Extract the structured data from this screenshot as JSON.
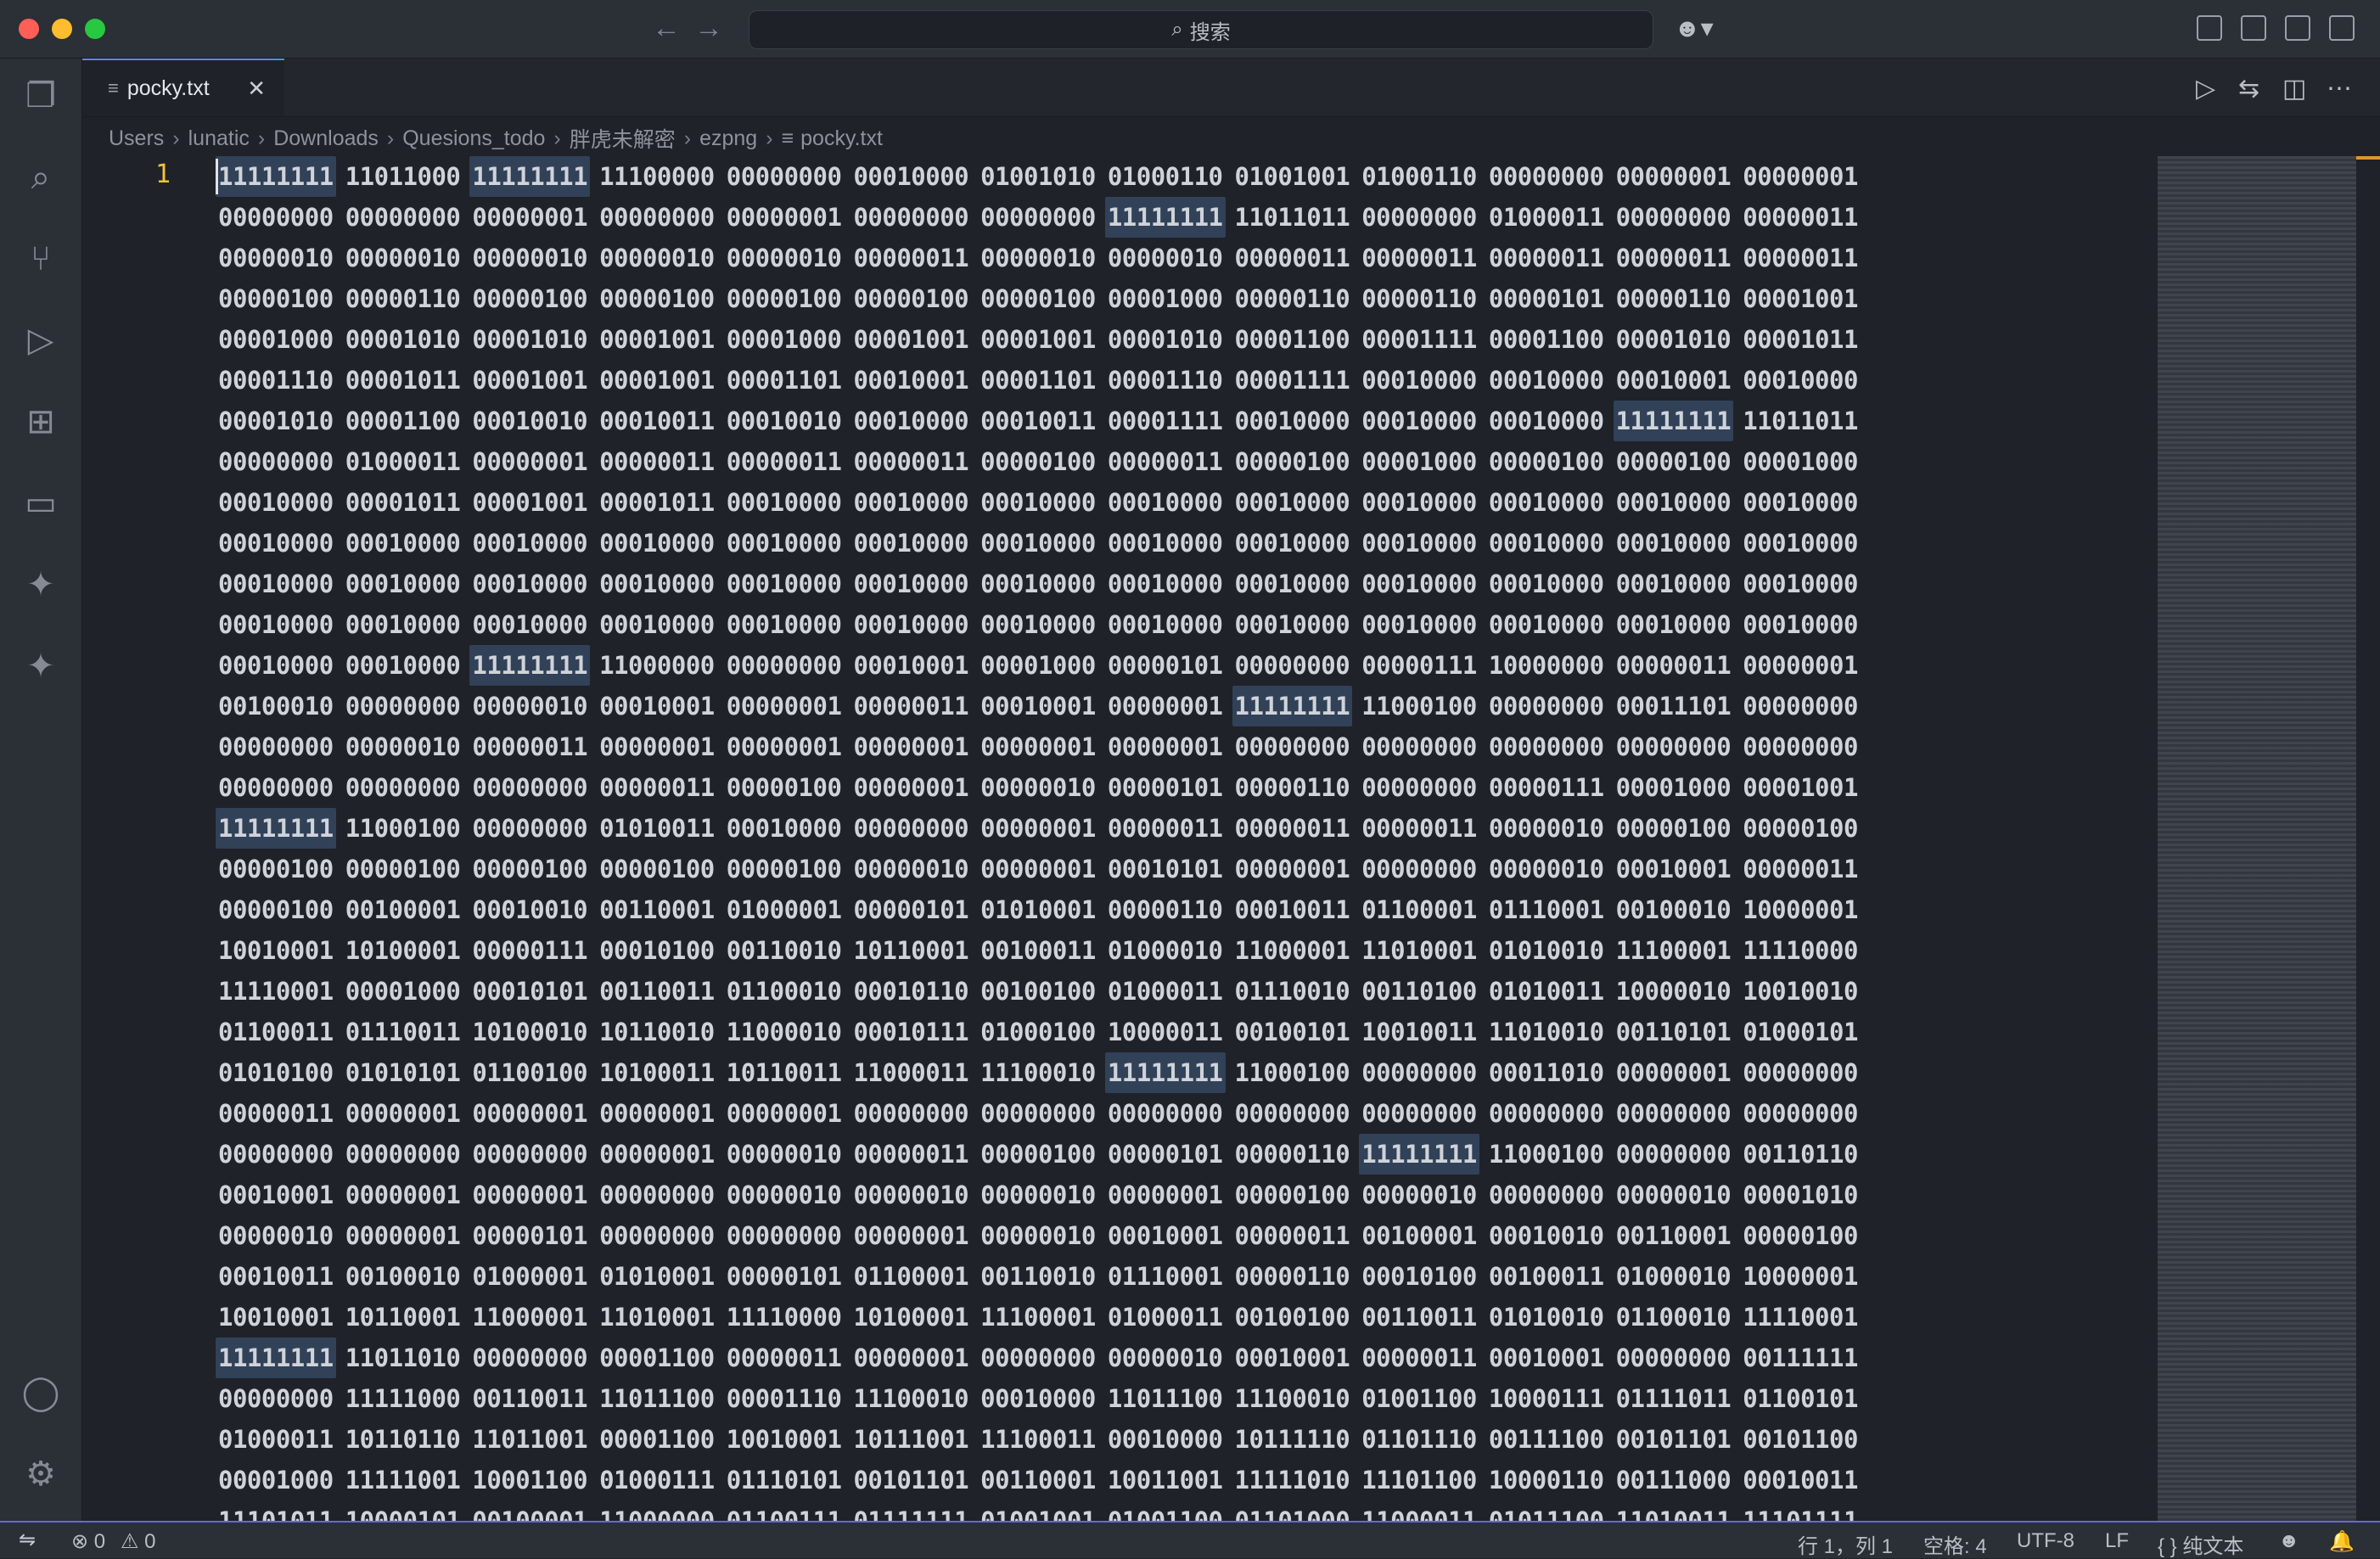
{
  "titlebar": {
    "search_placeholder": "搜索",
    "search_icon": "magnifier-icon",
    "copilot_icon": "copilot-icon"
  },
  "tab": {
    "file_icon": "text-file-icon",
    "name": "pocky.txt",
    "close": "✕"
  },
  "breadcrumb": {
    "parts": [
      "Users",
      "lunatic",
      "Downloads",
      "Quesions_todo",
      "胖虎未解密",
      "ezpng"
    ],
    "file": "pocky.txt"
  },
  "editor": {
    "line_number": "1",
    "lines": [
      [
        "11111111",
        "11011000",
        "11111111",
        "11100000",
        "00000000",
        "00010000",
        "01001010",
        "01000110",
        "01001001",
        "01000110",
        "00000000",
        "00000001",
        "00000001"
      ],
      [
        "00000000",
        "00000000",
        "00000001",
        "00000000",
        "00000001",
        "00000000",
        "00000000",
        "11111111",
        "11011011",
        "00000000",
        "01000011",
        "00000000",
        "00000011"
      ],
      [
        "00000010",
        "00000010",
        "00000010",
        "00000010",
        "00000010",
        "00000011",
        "00000010",
        "00000010",
        "00000011",
        "00000011",
        "00000011",
        "00000011",
        "00000011"
      ],
      [
        "00000100",
        "00000110",
        "00000100",
        "00000100",
        "00000100",
        "00000100",
        "00000100",
        "00001000",
        "00000110",
        "00000110",
        "00000101",
        "00000110",
        "00001001"
      ],
      [
        "00001000",
        "00001010",
        "00001010",
        "00001001",
        "00001000",
        "00001001",
        "00001001",
        "00001010",
        "00001100",
        "00001111",
        "00001100",
        "00001010",
        "00001011"
      ],
      [
        "00001110",
        "00001011",
        "00001001",
        "00001001",
        "00001101",
        "00010001",
        "00001101",
        "00001110",
        "00001111",
        "00010000",
        "00010000",
        "00010001",
        "00010000"
      ],
      [
        "00001010",
        "00001100",
        "00010010",
        "00010011",
        "00010010",
        "00010000",
        "00010011",
        "00001111",
        "00010000",
        "00010000",
        "00010000",
        "11111111",
        "11011011"
      ],
      [
        "00000000",
        "01000011",
        "00000001",
        "00000011",
        "00000011",
        "00000011",
        "00000100",
        "00000011",
        "00000100",
        "00001000",
        "00000100",
        "00000100",
        "00001000"
      ],
      [
        "00010000",
        "00001011",
        "00001001",
        "00001011",
        "00010000",
        "00010000",
        "00010000",
        "00010000",
        "00010000",
        "00010000",
        "00010000",
        "00010000",
        "00010000"
      ],
      [
        "00010000",
        "00010000",
        "00010000",
        "00010000",
        "00010000",
        "00010000",
        "00010000",
        "00010000",
        "00010000",
        "00010000",
        "00010000",
        "00010000",
        "00010000"
      ],
      [
        "00010000",
        "00010000",
        "00010000",
        "00010000",
        "00010000",
        "00010000",
        "00010000",
        "00010000",
        "00010000",
        "00010000",
        "00010000",
        "00010000",
        "00010000"
      ],
      [
        "00010000",
        "00010000",
        "00010000",
        "00010000",
        "00010000",
        "00010000",
        "00010000",
        "00010000",
        "00010000",
        "00010000",
        "00010000",
        "00010000",
        "00010000"
      ],
      [
        "00010000",
        "00010000",
        "11111111",
        "11000000",
        "00000000",
        "00010001",
        "00001000",
        "00000101",
        "00000000",
        "00000111",
        "10000000",
        "00000011",
        "00000001"
      ],
      [
        "00100010",
        "00000000",
        "00000010",
        "00010001",
        "00000001",
        "00000011",
        "00010001",
        "00000001",
        "11111111",
        "11000100",
        "00000000",
        "00011101",
        "00000000"
      ],
      [
        "00000000",
        "00000010",
        "00000011",
        "00000001",
        "00000001",
        "00000001",
        "00000001",
        "00000001",
        "00000000",
        "00000000",
        "00000000",
        "00000000",
        "00000000"
      ],
      [
        "00000000",
        "00000000",
        "00000000",
        "00000011",
        "00000100",
        "00000001",
        "00000010",
        "00000101",
        "00000110",
        "00000000",
        "00000111",
        "00001000",
        "00001001"
      ],
      [
        "11111111",
        "11000100",
        "00000000",
        "01010011",
        "00010000",
        "00000000",
        "00000001",
        "00000011",
        "00000011",
        "00000011",
        "00000010",
        "00000100",
        "00000100"
      ],
      [
        "00000100",
        "00000100",
        "00000100",
        "00000100",
        "00000100",
        "00000010",
        "00000001",
        "00010101",
        "00000001",
        "00000000",
        "00000010",
        "00010001",
        "00000011"
      ],
      [
        "00000100",
        "00100001",
        "00010010",
        "00110001",
        "01000001",
        "00000101",
        "01010001",
        "00000110",
        "00010011",
        "01100001",
        "01110001",
        "00100010",
        "10000001"
      ],
      [
        "10010001",
        "10100001",
        "00000111",
        "00010100",
        "00110010",
        "10110001",
        "00100011",
        "01000010",
        "11000001",
        "11010001",
        "01010010",
        "11100001",
        "11110000"
      ],
      [
        "11110001",
        "00001000",
        "00010101",
        "00110011",
        "01100010",
        "00010110",
        "00100100",
        "01000011",
        "01110010",
        "00110100",
        "01010011",
        "10000010",
        "10010010"
      ],
      [
        "01100011",
        "01110011",
        "10100010",
        "10110010",
        "11000010",
        "00010111",
        "01000100",
        "10000011",
        "00100101",
        "10010011",
        "11010010",
        "00110101",
        "01000101"
      ],
      [
        "01010100",
        "01010101",
        "01100100",
        "10100011",
        "10110011",
        "11000011",
        "11100010",
        "11111111",
        "11000100",
        "00000000",
        "00011010",
        "00000001",
        "00000000"
      ],
      [
        "00000011",
        "00000001",
        "00000001",
        "00000001",
        "00000001",
        "00000000",
        "00000000",
        "00000000",
        "00000000",
        "00000000",
        "00000000",
        "00000000",
        "00000000"
      ],
      [
        "00000000",
        "00000000",
        "00000000",
        "00000001",
        "00000010",
        "00000011",
        "00000100",
        "00000101",
        "00000110",
        "11111111",
        "11000100",
        "00000000",
        "00110110"
      ],
      [
        "00010001",
        "00000001",
        "00000001",
        "00000000",
        "00000010",
        "00000010",
        "00000010",
        "00000001",
        "00000100",
        "00000010",
        "00000000",
        "00000010",
        "00001010"
      ],
      [
        "00000010",
        "00000001",
        "00000101",
        "00000000",
        "00000000",
        "00000001",
        "00000010",
        "00010001",
        "00000011",
        "00100001",
        "00010010",
        "00110001",
        "00000100"
      ],
      [
        "00010011",
        "00100010",
        "01000001",
        "01010001",
        "00000101",
        "01100001",
        "00110010",
        "01110001",
        "00000110",
        "00010100",
        "00100011",
        "01000010",
        "10000001"
      ],
      [
        "10010001",
        "10110001",
        "11000001",
        "11010001",
        "11110000",
        "10100001",
        "11100001",
        "01000011",
        "00100100",
        "00110011",
        "01010010",
        "01100010",
        "11110001"
      ],
      [
        "11111111",
        "11011010",
        "00000000",
        "00001100",
        "00000011",
        "00000001",
        "00000000",
        "00000010",
        "00010001",
        "00000011",
        "00010001",
        "00000000",
        "00111111"
      ],
      [
        "00000000",
        "11111000",
        "00110011",
        "11011100",
        "00001110",
        "11100010",
        "00010000",
        "11011100",
        "11100010",
        "01001100",
        "10000111",
        "01111011",
        "01100101"
      ],
      [
        "01000011",
        "10110110",
        "11011001",
        "00001100",
        "10010001",
        "10111001",
        "11100011",
        "00010000",
        "10111110",
        "01101110",
        "00111100",
        "00101101",
        "00101100"
      ],
      [
        "00001000",
        "11111001",
        "10001100",
        "01000111",
        "01110101",
        "00101101",
        "00110001",
        "10011001",
        "11111010",
        "11101100",
        "10000110",
        "00111000",
        "00010011"
      ],
      [
        "11101011",
        "10000101",
        "00100001",
        "11000000",
        "01100111",
        "01111111",
        "01001001",
        "01001100",
        "01101000",
        "11000011",
        "01011100",
        "11010011",
        "11101111"
      ]
    ]
  },
  "statusbar": {
    "remote_icon": "remote-icon",
    "errors": "⊗ 0",
    "warnings": "⚠ 0",
    "position": "行 1，列 1",
    "spaces": "空格: 4",
    "encoding": "UTF-8",
    "eol": "LF",
    "language": "{ } 纯文本",
    "copilot_icon": "copilot-icon",
    "bell_icon": "bell-icon"
  },
  "colors": {
    "accent": "#528bff",
    "highlight": "#314158",
    "line_number": "#f0c53a",
    "status_border": "#6b66d8"
  }
}
